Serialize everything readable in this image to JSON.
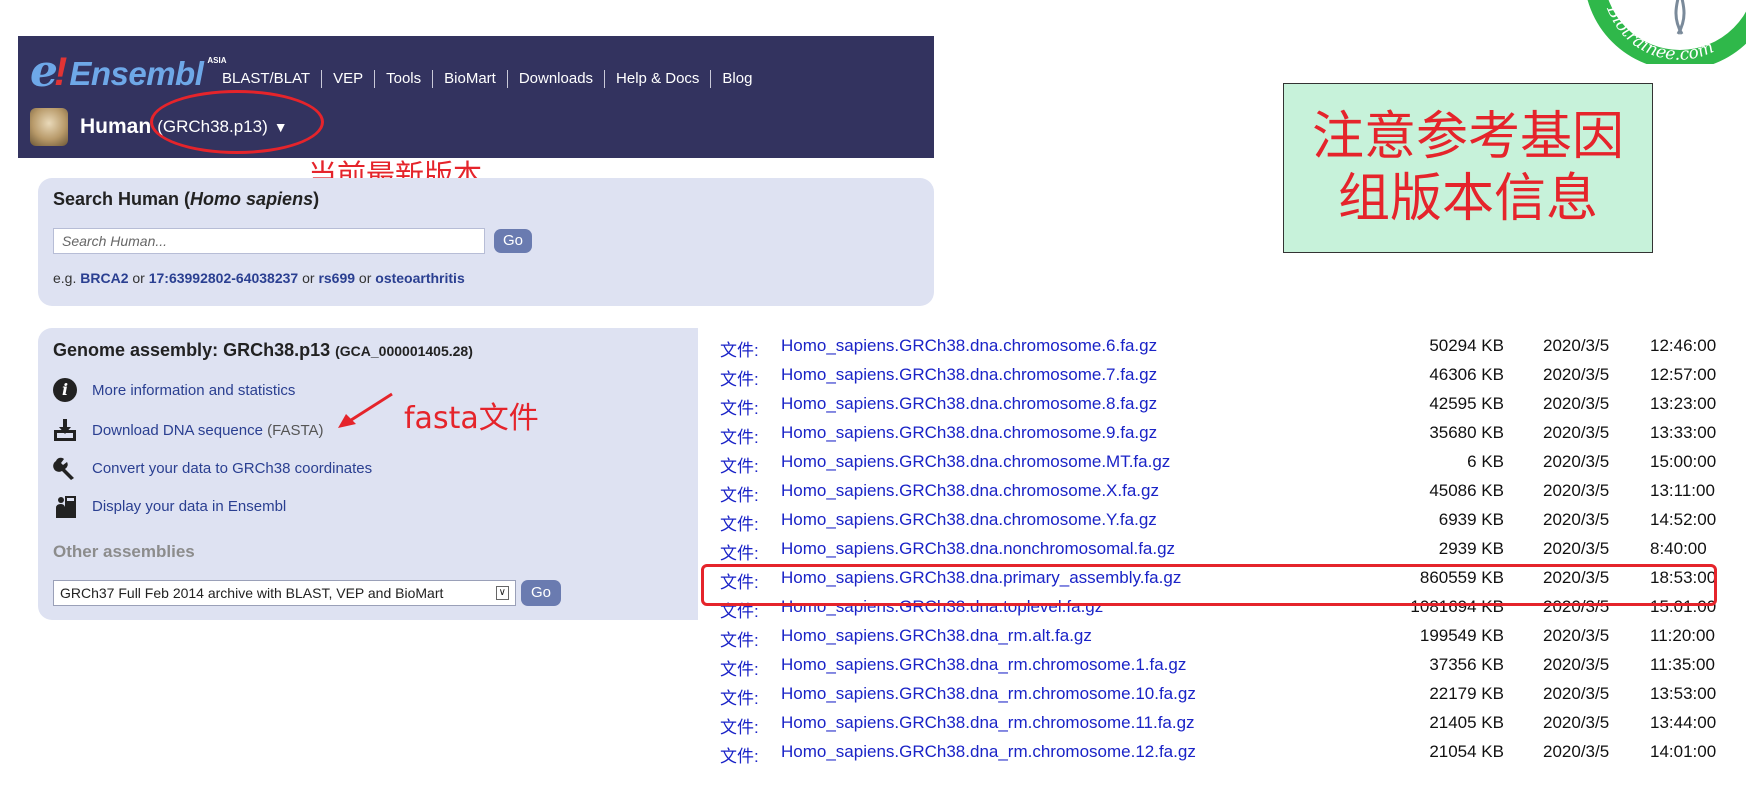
{
  "header": {
    "logo_e": "e",
    "logo_bang": "!",
    "logo_text": "Ensembl",
    "logo_asia": "ASIA",
    "nav": [
      "BLAST/BLAT",
      "VEP",
      "Tools",
      "BioMart",
      "Downloads",
      "Help & Docs",
      "Blog"
    ],
    "species_name": "Human",
    "species_version": "(GRCh38.p13)",
    "species_caret": "▼"
  },
  "annotations": {
    "latest_version": "当前最新版本",
    "fasta_file": "fasta文件",
    "note": [
      "注意参考基因",
      "组版本信息"
    ],
    "colors": {
      "red": "#e5242b",
      "note_bg": "#c7f2da"
    }
  },
  "search": {
    "title_prefix": "Search Human (",
    "title_italic": "Homo sapiens",
    "title_suffix": ")",
    "placeholder": "Search Human...",
    "go": "Go",
    "examples_prefix": "e.g.",
    "examples": [
      "BRCA2",
      "17:63992802-64038237",
      "rs699",
      "osteoarthritis"
    ],
    "examples_sep": "or"
  },
  "genome": {
    "title": "Genome assembly: GRCh38.p13",
    "accession": "(GCA_000001405.28)",
    "links": [
      {
        "label": "More information and statistics",
        "icon": "info-icon"
      },
      {
        "label": "Download DNA sequence",
        "suffix": "(FASTA)",
        "icon": "download-icon"
      },
      {
        "label": "Convert your data to GRCh38 coordinates",
        "icon": "wrench-icon"
      },
      {
        "label": "Display your data in Ensembl",
        "icon": "upload-data-icon"
      }
    ],
    "other_title": "Other assemblies",
    "other_selected": "GRCh37 Full Feb 2014 archive with BLAST, VEP and BioMart",
    "other_go": "Go"
  },
  "files": {
    "type_label": "文件:",
    "rows": [
      {
        "name": "Homo_sapiens.GRCh38.dna.chromosome.6.fa.gz",
        "size": "50294 KB",
        "date": "2020/3/5",
        "time": "12:46:00"
      },
      {
        "name": "Homo_sapiens.GRCh38.dna.chromosome.7.fa.gz",
        "size": "46306 KB",
        "date": "2020/3/5",
        "time": "12:57:00"
      },
      {
        "name": "Homo_sapiens.GRCh38.dna.chromosome.8.fa.gz",
        "size": "42595 KB",
        "date": "2020/3/5",
        "time": "13:23:00"
      },
      {
        "name": "Homo_sapiens.GRCh38.dna.chromosome.9.fa.gz",
        "size": "35680 KB",
        "date": "2020/3/5",
        "time": "13:33:00"
      },
      {
        "name": "Homo_sapiens.GRCh38.dna.chromosome.MT.fa.gz",
        "size": "6 KB",
        "date": "2020/3/5",
        "time": "15:00:00"
      },
      {
        "name": "Homo_sapiens.GRCh38.dna.chromosome.X.fa.gz",
        "size": "45086 KB",
        "date": "2020/3/5",
        "time": "13:11:00"
      },
      {
        "name": "Homo_sapiens.GRCh38.dna.chromosome.Y.fa.gz",
        "size": "6939 KB",
        "date": "2020/3/5",
        "time": "14:52:00"
      },
      {
        "name": "Homo_sapiens.GRCh38.dna.nonchromosomal.fa.gz",
        "size": "2939 KB",
        "date": "2020/3/5",
        "time": "8:40:00"
      },
      {
        "name": "Homo_sapiens.GRCh38.dna.primary_assembly.fa.gz",
        "size": "860559 KB",
        "date": "2020/3/5",
        "time": "18:53:00",
        "highlighted": true
      },
      {
        "name": "Homo_sapiens.GRCh38.dna.toplevel.fa.gz",
        "size": "1081694 KB",
        "date": "2020/3/5",
        "time": "15:01:00"
      },
      {
        "name": "Homo_sapiens.GRCh38.dna_rm.alt.fa.gz",
        "size": "199549 KB",
        "date": "2020/3/5",
        "time": "11:20:00"
      },
      {
        "name": "Homo_sapiens.GRCh38.dna_rm.chromosome.1.fa.gz",
        "size": "37356 KB",
        "date": "2020/3/5",
        "time": "11:35:00"
      },
      {
        "name": "Homo_sapiens.GRCh38.dna_rm.chromosome.10.fa.gz",
        "size": "22179 KB",
        "date": "2020/3/5",
        "time": "13:53:00"
      },
      {
        "name": "Homo_sapiens.GRCh38.dna_rm.chromosome.11.fa.gz",
        "size": "21405 KB",
        "date": "2020/3/5",
        "time": "13:44:00"
      },
      {
        "name": "Homo_sapiens.GRCh38.dna_rm.chromosome.12.fa.gz",
        "size": "21054 KB",
        "date": "2020/3/5",
        "time": "14:01:00"
      }
    ]
  },
  "watermark": {
    "text": "Biotrainee.com",
    "ring_color": "#2fb84a"
  }
}
